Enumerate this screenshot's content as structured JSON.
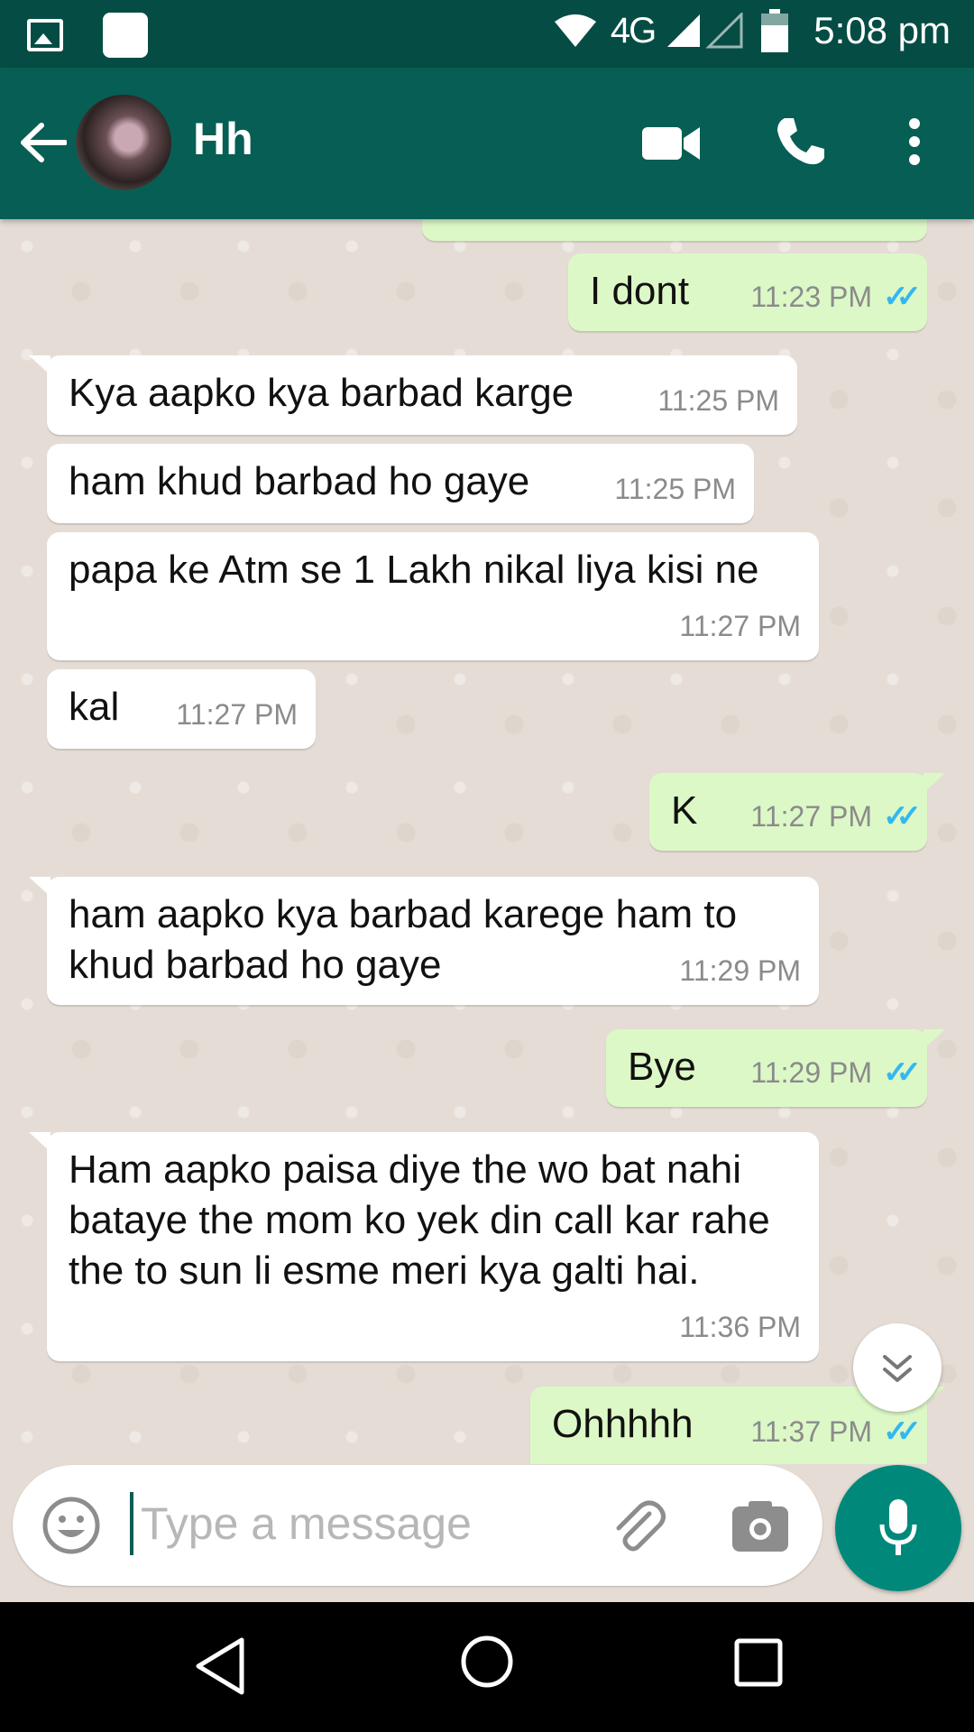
{
  "status_bar": {
    "network": "4G",
    "time": "5:08 pm",
    "icons": [
      "image-icon",
      "app-icon",
      "wifi-icon",
      "signal-icon",
      "battery-icon"
    ]
  },
  "header": {
    "contact_name": "Hh",
    "icons": [
      "back-arrow-icon",
      "video-call-icon",
      "phone-icon",
      "more-vert-icon"
    ]
  },
  "messages": [
    {
      "direction": "out",
      "text": "I dont",
      "time": "11:23 PM",
      "ticks": "✓✓"
    },
    {
      "direction": "in",
      "text": "Kya aapko kya barbad karge",
      "time": "11:25 PM"
    },
    {
      "direction": "in",
      "text": "ham khud barbad ho gaye",
      "time": "11:25 PM"
    },
    {
      "direction": "in",
      "text": "papa ke Atm se 1 Lakh nikal liya kisi ne",
      "time": "11:27 PM"
    },
    {
      "direction": "in",
      "text": "kal",
      "time": "11:27 PM"
    },
    {
      "direction": "out",
      "text": "K",
      "time": "11:27 PM",
      "ticks": "✓✓"
    },
    {
      "direction": "in",
      "text": "ham aapko kya barbad karege ham to khud barbad ho gaye",
      "time": "11:29 PM"
    },
    {
      "direction": "out",
      "text": "Bye",
      "time": "11:29 PM",
      "ticks": "✓✓"
    },
    {
      "direction": "in",
      "text": "Ham aapko paisa diye the wo bat nahi bataye the mom ko yek din call kar rahe the to sun li esme meri kya galti hai.",
      "time": "11:36 PM"
    },
    {
      "direction": "out",
      "text": "Ohhhhh",
      "time": "11:37 PM",
      "ticks": "✓✓"
    }
  ],
  "input": {
    "placeholder": "Type a message",
    "value": ""
  },
  "colors": {
    "header": "#075e54",
    "status_bar": "#054d44",
    "outgoing_bubble": "#dcf8c6",
    "incoming_bubble": "#ffffff",
    "read_ticks": "#34b7f1",
    "mic_button": "#00897b"
  }
}
